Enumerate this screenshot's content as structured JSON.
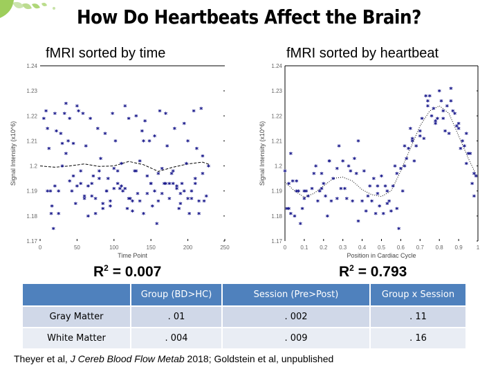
{
  "slide": {
    "title": "How Do Heartbeats Affect the Brain?",
    "left_subtitle": "fMRI sorted by time",
    "right_subtitle": "fMRI sorted by heartbeat",
    "left_r2_label": "R",
    "left_r2_sup": "2",
    "left_r2_value": " = 0.007",
    "right_r2_label": "R",
    "right_r2_sup": "2",
    "right_r2_value": " = 0.793",
    "citation_prefix": "Theyer et al, ",
    "citation_journal": "J Cereb Blood Flow Metab",
    "citation_suffix": " 2018; Goldstein et al, unpublished"
  },
  "table": {
    "headers": [
      "",
      "Group (BD>HC)",
      "Session (Pre>Post)",
      "Group x Session"
    ],
    "rows": [
      [
        "Gray Matter",
        ". 01",
        ". 002",
        ". 11"
      ],
      [
        "White Matter",
        ". 004",
        ". 009",
        ". 16"
      ]
    ]
  },
  "colors": {
    "marker": "#1a1a8c",
    "header": "#4f81bd",
    "row1": "#d0d8e8",
    "row2": "#e9edf4",
    "leaf": "#8dc63f"
  },
  "chart_data": [
    {
      "type": "scatter",
      "title": "fMRI sorted by time",
      "xlabel": "Time Point",
      "ylabel": "Signal Intensity (x10^6)",
      "xlim": [
        0,
        250
      ],
      "ylim": [
        1.17,
        1.24
      ],
      "xticks": [
        "0",
        "50",
        "100",
        "150",
        "200",
        "250"
      ],
      "yticks": [
        "1.17",
        "1.18",
        "1.19",
        "1.2",
        "1.21",
        "1.22",
        "1.23",
        "1.24"
      ],
      "annotation": "R2 = 0.007",
      "fit_line": {
        "x": [
          0,
          20,
          40,
          60,
          80,
          100,
          120,
          140,
          160,
          180,
          200,
          220,
          230
        ],
        "y": [
          1.2,
          1.1995,
          1.2,
          1.2008,
          1.1998,
          1.2,
          1.2018,
          1.2005,
          1.1978,
          1.1995,
          1.2008,
          1.2015,
          1.2005
        ]
      },
      "points": {
        "x": [
          5,
          8,
          10,
          12,
          14,
          16,
          18,
          20,
          22,
          25,
          28,
          30,
          33,
          35,
          38,
          40,
          43,
          45,
          48,
          50,
          52,
          55,
          58,
          60,
          62,
          65,
          68,
          70,
          72,
          75,
          78,
          80,
          82,
          85,
          88,
          90,
          92,
          95,
          98,
          100,
          102,
          105,
          108,
          110,
          112,
          115,
          118,
          120,
          122,
          125,
          128,
          130,
          132,
          135,
          138,
          140,
          142,
          145,
          148,
          150,
          152,
          155,
          158,
          160,
          162,
          165,
          168,
          170,
          172,
          175,
          178,
          180,
          182,
          185,
          188,
          190,
          192,
          195,
          198,
          200,
          202,
          205,
          208,
          210,
          212,
          215,
          218,
          220,
          222,
          225,
          228,
          10,
          30,
          50,
          70,
          90,
          110,
          130,
          150,
          170,
          190,
          210,
          15,
          35,
          55,
          75,
          95,
          115,
          135,
          155,
          175,
          195,
          215,
          20,
          40,
          60,
          80,
          100,
          120,
          140,
          160,
          180,
          200,
          220,
          25,
          45,
          65,
          85,
          105,
          125,
          145,
          165,
          185,
          205
        ],
        "y": [
          1.219,
          1.222,
          1.215,
          1.207,
          1.19,
          1.184,
          1.175,
          1.221,
          1.214,
          1.181,
          1.213,
          1.209,
          1.221,
          1.225,
          1.21,
          1.219,
          1.19,
          1.209,
          1.185,
          1.224,
          1.222,
          1.193,
          1.221,
          1.187,
          1.208,
          1.18,
          1.219,
          1.193,
          1.196,
          1.181,
          1.215,
          1.195,
          1.203,
          1.183,
          1.213,
          1.19,
          1.195,
          1.186,
          1.221,
          1.199,
          1.21,
          1.193,
          1.191,
          1.201,
          1.19,
          1.224,
          1.183,
          1.219,
          1.187,
          1.182,
          1.198,
          1.22,
          1.189,
          1.186,
          1.214,
          1.21,
          1.218,
          1.196,
          1.21,
          1.193,
          1.184,
          1.212,
          1.177,
          1.186,
          1.222,
          1.199,
          1.193,
          1.221,
          1.208,
          1.193,
          1.197,
          1.198,
          1.215,
          1.192,
          1.183,
          1.189,
          1.193,
          1.217,
          1.201,
          1.21,
          1.181,
          1.19,
          1.222,
          1.193,
          1.207,
          1.181,
          1.223,
          1.204,
          1.186,
          1.188,
          1.2,
          1.19,
          1.2,
          1.192,
          1.188,
          1.19,
          1.192,
          1.198,
          1.193,
          1.193,
          1.185,
          1.195,
          1.181,
          1.205,
          1.198,
          1.187,
          1.184,
          1.191,
          1.202,
          1.19,
          1.187,
          1.19,
          1.186,
          1.192,
          1.194,
          1.188,
          1.198,
          1.191,
          1.187,
          1.181,
          1.197,
          1.193,
          1.187,
          1.197,
          1.19,
          1.196,
          1.192,
          1.185,
          1.198,
          1.186,
          1.189,
          1.189,
          1.191,
          1.187,
          1.194,
          1.192
        ]
      }
    },
    {
      "type": "scatter",
      "title": "fMRI sorted by heartbeat",
      "xlabel": "Position in Cardiac Cycle",
      "ylabel": "Signal Intensity (x10^6)",
      "xlim": [
        0,
        1
      ],
      "ylim": [
        1.17,
        1.24
      ],
      "xticks": [
        "0",
        "0.1",
        "0.2",
        "0.3",
        "0.4",
        "0.5",
        "0.6",
        "0.7",
        "0.8",
        "0.9",
        "1"
      ],
      "yticks": [
        "1.17",
        "1.18",
        "1.19",
        "1.2",
        "1.21",
        "1.22",
        "1.23",
        "1.24"
      ],
      "annotation": "R2 = 0.793",
      "fit_line": {
        "x": [
          0,
          0.05,
          0.1,
          0.15,
          0.2,
          0.25,
          0.3,
          0.35,
          0.4,
          0.45,
          0.5,
          0.55,
          0.6,
          0.65,
          0.7,
          0.75,
          0.8,
          0.85,
          0.9,
          0.95,
          1.0
        ],
        "y": [
          1.1935,
          1.19,
          1.1875,
          1.189,
          1.192,
          1.195,
          1.1955,
          1.194,
          1.1905,
          1.1885,
          1.1878,
          1.19,
          1.198,
          1.207,
          1.216,
          1.222,
          1.224,
          1.221,
          1.212,
          1.203,
          1.195
        ]
      },
      "points": {
        "x": [
          0,
          0.01,
          0.02,
          0.03,
          0.03,
          0.04,
          0.05,
          0.06,
          0.07,
          0.08,
          0.09,
          0.1,
          0.11,
          0.12,
          0.14,
          0.16,
          0.17,
          0.18,
          0.19,
          0.2,
          0.21,
          0.22,
          0.23,
          0.24,
          0.25,
          0.27,
          0.28,
          0.29,
          0.3,
          0.31,
          0.32,
          0.34,
          0.35,
          0.36,
          0.37,
          0.38,
          0.4,
          0.41,
          0.42,
          0.44,
          0.45,
          0.46,
          0.47,
          0.48,
          0.49,
          0.5,
          0.51,
          0.52,
          0.53,
          0.54,
          0.55,
          0.56,
          0.57,
          0.58,
          0.59,
          0.6,
          0.61,
          0.62,
          0.63,
          0.64,
          0.65,
          0.66,
          0.67,
          0.68,
          0.7,
          0.71,
          0.72,
          0.73,
          0.74,
          0.75,
          0.76,
          0.77,
          0.78,
          0.79,
          0.8,
          0.81,
          0.82,
          0.83,
          0.84,
          0.85,
          0.86,
          0.87,
          0.88,
          0.89,
          0.9,
          0.91,
          0.92,
          0.93,
          0.94,
          0.95,
          0.96,
          0.97,
          0.98,
          0.99,
          0.02,
          0.06,
          0.1,
          0.15,
          0.19,
          0.23,
          0.27,
          0.33,
          0.38,
          0.43,
          0.48,
          0.53,
          0.58,
          0.62,
          0.66,
          0.7,
          0.74,
          0.78,
          0.82,
          0.86,
          0.9,
          0.94,
          0.98
        ],
        "y": [
          1.198,
          1.183,
          1.193,
          1.205,
          1.181,
          1.194,
          1.18,
          1.194,
          1.19,
          1.177,
          1.183,
          1.187,
          1.19,
          1.188,
          1.191,
          1.2,
          1.186,
          1.19,
          1.197,
          1.193,
          1.188,
          1.18,
          1.202,
          1.186,
          1.195,
          1.199,
          1.208,
          1.191,
          1.202,
          1.191,
          1.187,
          1.198,
          1.186,
          1.203,
          1.197,
          1.178,
          1.186,
          1.198,
          1.182,
          1.192,
          1.186,
          1.195,
          1.181,
          1.189,
          1.184,
          1.196,
          1.181,
          1.192,
          1.19,
          1.186,
          1.182,
          1.192,
          1.2,
          1.197,
          1.175,
          1.199,
          1.19,
          1.208,
          1.203,
          1.207,
          1.215,
          1.211,
          1.202,
          1.208,
          1.214,
          1.219,
          1.211,
          1.228,
          1.224,
          1.228,
          1.22,
          1.223,
          1.217,
          1.219,
          1.23,
          1.226,
          1.219,
          1.214,
          1.224,
          1.213,
          1.231,
          1.222,
          1.221,
          1.216,
          1.217,
          1.207,
          1.21,
          1.208,
          1.201,
          1.205,
          1.205,
          1.193,
          1.197,
          1.196,
          1.183,
          1.19,
          1.19,
          1.197,
          1.191,
          1.202,
          1.187,
          1.2,
          1.21,
          1.188,
          1.192,
          1.185,
          1.183,
          1.2,
          1.21,
          1.212,
          1.226,
          1.218,
          1.222,
          1.226,
          1.215,
          1.213,
          1.188
        ]
      }
    }
  ]
}
